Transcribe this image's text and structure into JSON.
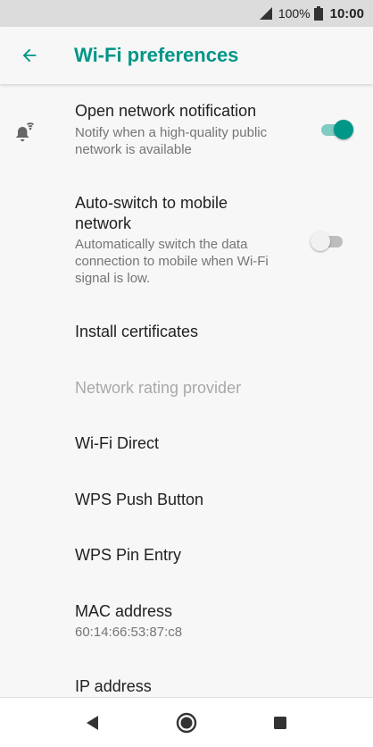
{
  "status_bar": {
    "battery_percent": "100%",
    "time": "10:00",
    "signal_icon": "cell-signal-icon",
    "battery_icon": "battery-icon"
  },
  "app_bar": {
    "title": "Wi-Fi preferences",
    "back_icon": "back-arrow-icon"
  },
  "items": {
    "open_network": {
      "title": "Open network notification",
      "subtitle": "Notify when a high-quality public network is available",
      "icon": "notification-wifi-icon",
      "toggle_on": true
    },
    "auto_switch": {
      "title": "Auto-switch to mobile network",
      "subtitle": "Automatically switch the data connection to mobile when Wi-Fi signal is low.",
      "toggle_on": false
    },
    "install_certs": {
      "title": "Install certificates"
    },
    "rating_provider": {
      "title": "Network rating provider",
      "disabled": true
    },
    "wifi_direct": {
      "title": "Wi-Fi Direct"
    },
    "wps_push": {
      "title": "WPS Push Button"
    },
    "wps_pin": {
      "title": "WPS Pin Entry"
    },
    "mac": {
      "title": "MAC address",
      "value": "60:14:66:53:87:c8"
    },
    "ip": {
      "title": "IP address"
    }
  },
  "nav_bar": {
    "back_icon": "nav-back-icon",
    "home_icon": "nav-home-icon",
    "recents_icon": "nav-recents-icon"
  },
  "colors": {
    "accent": "#009688",
    "status_bar_bg": "#dcdcdc",
    "background": "#f7f7f7"
  }
}
